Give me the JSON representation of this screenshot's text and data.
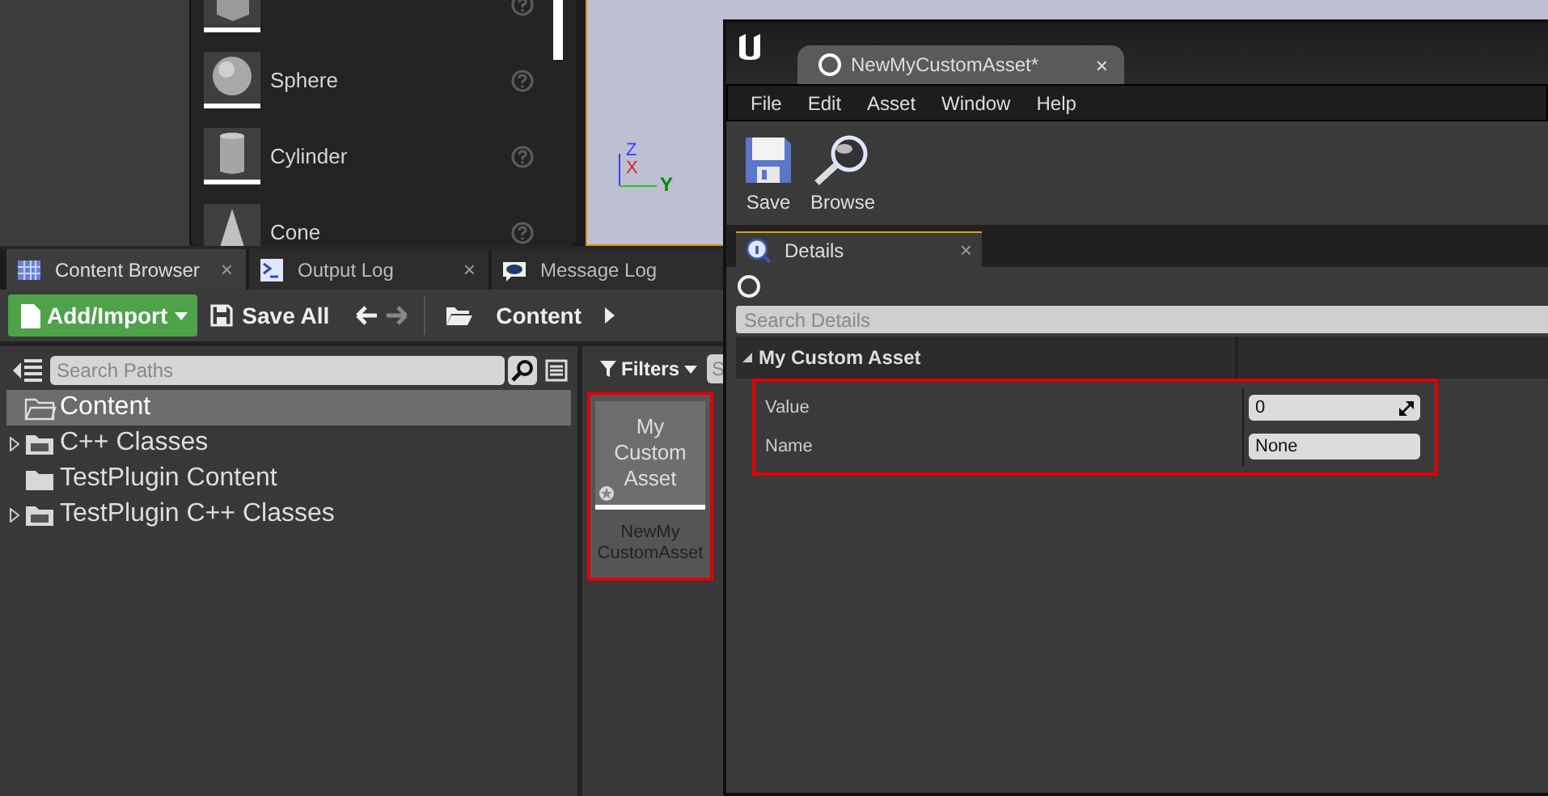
{
  "place_actors": {
    "items": [
      {
        "kind": "cube"
      },
      {
        "label": "Sphere",
        "kind": "sphere"
      },
      {
        "label": "Cylinder",
        "kind": "cylinder"
      },
      {
        "label": "Cone",
        "kind": "cone"
      }
    ]
  },
  "viewport": {
    "axes": {
      "z": "Z",
      "x": "X",
      "y": "Y"
    }
  },
  "panel_tabs": [
    {
      "label": "Content Browser",
      "kind": "grid",
      "selected": true,
      "close": "×"
    },
    {
      "label": "Output Log",
      "kind": "log",
      "selected": false,
      "close": "×"
    },
    {
      "label": "Message Log",
      "kind": "message",
      "selected": false
    }
  ],
  "toolbar": {
    "add_import": "Add/Import",
    "save_all": "Save All",
    "path": "Content"
  },
  "sources": {
    "search_placeholder": "Search Paths",
    "tree": [
      {
        "label": "Content",
        "kind": "open-folder",
        "selected": true,
        "expandable": false
      },
      {
        "label": "C++ Classes",
        "kind": "code-folder",
        "selected": false,
        "expandable": true
      },
      {
        "label": "TestPlugin Content",
        "kind": "folder",
        "selected": false,
        "expandable": false
      },
      {
        "label": "TestPlugin C++ Classes",
        "kind": "code-folder",
        "selected": false,
        "expandable": true
      }
    ]
  },
  "assets": {
    "filters": "Filters",
    "search_placeholder": "S",
    "items": [
      {
        "thumbnail": "My Custom Asset",
        "name_lines": [
          "NewMy",
          "CustomAsset"
        ],
        "highlighted": true
      }
    ]
  },
  "editor": {
    "tab": "NewMyCustomAsset*",
    "close": "×",
    "menu": [
      "File",
      "Edit",
      "Asset",
      "Window",
      "Help"
    ],
    "toolbar": [
      {
        "label": "Save",
        "kind": "save"
      },
      {
        "label": "Browse",
        "kind": "browse"
      }
    ],
    "details_tab": {
      "label": "Details",
      "close": "×"
    },
    "search_placeholder": "Search Details",
    "category": "My Custom Asset",
    "properties_highlighted": true,
    "properties": [
      {
        "label": "Value",
        "value": "0",
        "kind": "number"
      },
      {
        "label": "Name",
        "value": "None",
        "kind": "text"
      }
    ]
  }
}
